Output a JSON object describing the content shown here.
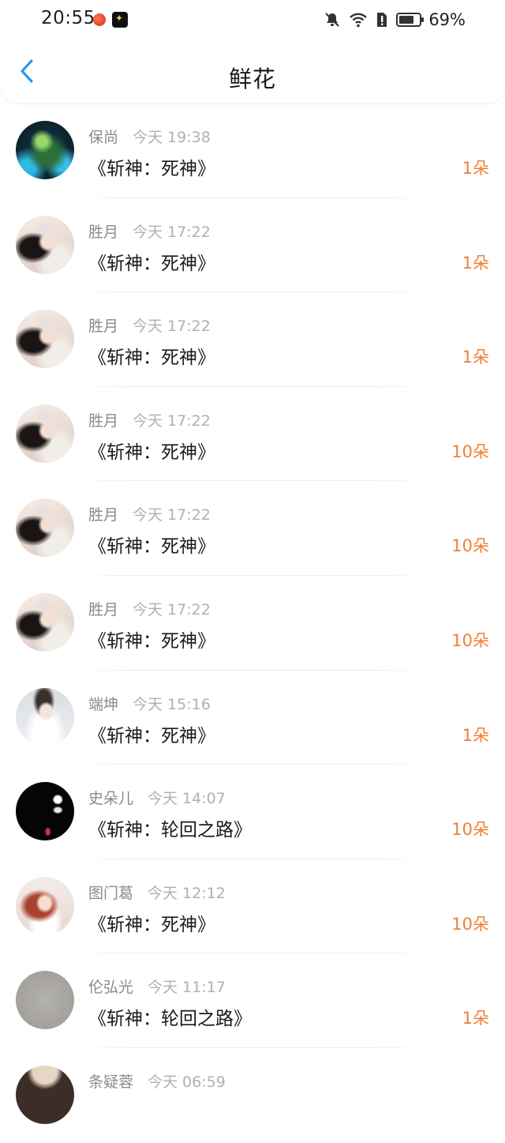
{
  "status_bar": {
    "time": "20:55",
    "battery_percent": "69%"
  },
  "nav": {
    "title": "鲜花"
  },
  "items": [
    {
      "user": "保尚",
      "time": "今天 19:38",
      "book": "《斩神：死神》",
      "count": "1朵",
      "avatar": "av-monster"
    },
    {
      "user": "胜月",
      "time": "今天 17:22",
      "book": "《斩神：死神》",
      "count": "1朵",
      "avatar": "av-girl"
    },
    {
      "user": "胜月",
      "time": "今天 17:22",
      "book": "《斩神：死神》",
      "count": "1朵",
      "avatar": "av-girl"
    },
    {
      "user": "胜月",
      "time": "今天 17:22",
      "book": "《斩神：死神》",
      "count": "10朵",
      "avatar": "av-girl"
    },
    {
      "user": "胜月",
      "time": "今天 17:22",
      "book": "《斩神：死神》",
      "count": "10朵",
      "avatar": "av-girl"
    },
    {
      "user": "胜月",
      "time": "今天 17:22",
      "book": "《斩神：死神》",
      "count": "10朵",
      "avatar": "av-girl"
    },
    {
      "user": "端坤",
      "time": "今天 15:16",
      "book": "《斩神：死神》",
      "count": "1朵",
      "avatar": "av-boy"
    },
    {
      "user": "史朵儿",
      "time": "今天 14:07",
      "book": "《斩神：轮回之路》",
      "count": "10朵",
      "avatar": "av-black"
    },
    {
      "user": "图门葛",
      "time": "今天 12:12",
      "book": "《斩神：死神》",
      "count": "10朵",
      "avatar": "av-redgirl"
    },
    {
      "user": "伦弘光",
      "time": "今天 11:17",
      "book": "《斩神：轮回之路》",
      "count": "1朵",
      "avatar": "av-grey"
    },
    {
      "user": "条疑蓉",
      "time": "今天 06:59",
      "book": "",
      "count": "",
      "avatar": "av-lace"
    }
  ]
}
